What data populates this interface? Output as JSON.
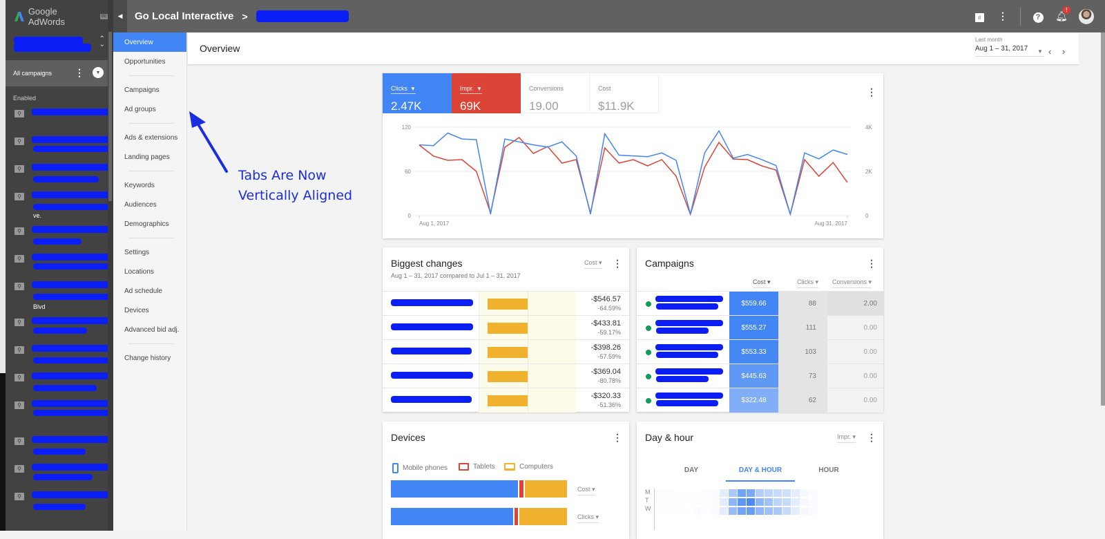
{
  "app": {
    "product_name": "Google AdWords",
    "beta_badge": "BETA"
  },
  "topbar": {
    "collapse_icon": "caret-left",
    "account_name": "Go Local Interactive",
    "separator": ">",
    "icons": [
      "reports-icon",
      "more-vert-icon",
      "help-icon",
      "notifications-icon",
      "avatar"
    ],
    "notification_badge": "!"
  },
  "sidebar": {
    "all_campaigns_label": "All campaigns",
    "enabled_label": "Enabled",
    "campaign_extra_texts": [
      "",
      "",
      "",
      "ve.",
      "",
      "",
      "Blvd",
      "",
      "",
      "",
      "",
      "",
      "",
      ""
    ]
  },
  "nav_tabs": [
    {
      "label": "Overview",
      "active": true
    },
    {
      "label": "Opportunities"
    },
    {
      "sep": true
    },
    {
      "label": "Campaigns"
    },
    {
      "label": "Ad groups"
    },
    {
      "sep": true
    },
    {
      "label": "Ads & extensions"
    },
    {
      "label": "Landing pages"
    },
    {
      "sep": true
    },
    {
      "label": "Keywords"
    },
    {
      "label": "Audiences"
    },
    {
      "label": "Demographics"
    },
    {
      "sep": true
    },
    {
      "label": "Settings"
    },
    {
      "label": "Locations"
    },
    {
      "label": "Ad schedule"
    },
    {
      "label": "Devices"
    },
    {
      "label": "Advanced bid adj."
    },
    {
      "sep": true
    },
    {
      "label": "Change history"
    }
  ],
  "page": {
    "title": "Overview",
    "date_range_label": "Last month",
    "date_range_value": "Aug 1 – 31, 2017",
    "prev": "‹",
    "next": "›"
  },
  "annotation": {
    "line1": "Tabs Are Now",
    "line2": "Vertically Aligned"
  },
  "summary_card": {
    "metrics": [
      {
        "label": "Clicks",
        "value": "2.47K",
        "color": "#4285f4",
        "selected": true
      },
      {
        "label": "Impr.",
        "value": "69K",
        "color": "#db4437",
        "selected": true
      },
      {
        "label": "Conversions",
        "value": "19.00",
        "selected": false
      },
      {
        "label": "Cost",
        "value": "$11.9K",
        "selected": false
      }
    ]
  },
  "chart_data": {
    "type": "line",
    "x": [
      "Aug 1",
      "Aug 2",
      "Aug 3",
      "Aug 4",
      "Aug 5",
      "Aug 6",
      "Aug 7",
      "Aug 8",
      "Aug 9",
      "Aug 10",
      "Aug 11",
      "Aug 12",
      "Aug 13",
      "Aug 14",
      "Aug 15",
      "Aug 16",
      "Aug 17",
      "Aug 18",
      "Aug 19",
      "Aug 20",
      "Aug 21",
      "Aug 22",
      "Aug 23",
      "Aug 24",
      "Aug 25",
      "Aug 26",
      "Aug 27",
      "Aug 28",
      "Aug 29",
      "Aug 30",
      "Aug 31"
    ],
    "x_tick_labels": [
      "Aug 1, 2017",
      "Aug 31, 2017"
    ],
    "left_axis": {
      "ticks": [
        "0",
        "60",
        "120"
      ],
      "range": [
        0,
        120
      ]
    },
    "right_axis": {
      "ticks": [
        "0",
        "2K",
        "4K"
      ],
      "range": [
        0,
        4000
      ]
    },
    "grid": true,
    "series": [
      {
        "name": "Clicks",
        "axis": "left",
        "color": "#4285f4",
        "values": [
          96,
          95,
          112,
          104,
          103,
          2,
          104,
          100,
          96,
          93,
          100,
          81,
          2,
          111,
          82,
          81,
          80,
          85,
          75,
          2,
          85,
          115,
          78,
          83,
          76,
          68,
          2,
          85,
          77,
          89,
          83
        ]
      },
      {
        "name": "Impr.",
        "axis": "right",
        "color": "#db4437",
        "values": [
          3190,
          2690,
          2500,
          2530,
          2000,
          125,
          3090,
          3530,
          2810,
          3125,
          2375,
          2530,
          125,
          3060,
          2375,
          2530,
          2250,
          2530,
          1780,
          60,
          2190,
          3310,
          2560,
          2530,
          2250,
          2060,
          60,
          2530,
          1780,
          2400,
          1500
        ]
      }
    ]
  },
  "biggest_changes": {
    "title": "Biggest changes",
    "subtitle": "Aug 1 – 31, 2017 compared to Jul 1 – 31, 2017",
    "metric_dropdown": "Cost",
    "rows": [
      {
        "amount": "-$546.57",
        "percent": "-64.59%",
        "change_fraction": 1.0
      },
      {
        "amount": "-$433.81",
        "percent": "-59.17%",
        "change_fraction": 1.0
      },
      {
        "amount": "-$398.26",
        "percent": "-57.59%",
        "change_fraction": 1.0
      },
      {
        "amount": "-$369.04",
        "percent": "-80.78%",
        "change_fraction": 1.0
      },
      {
        "amount": "-$320.33",
        "percent": "-51.36%",
        "change_fraction": 1.0
      }
    ]
  },
  "campaigns_card": {
    "title": "Campaigns",
    "columns": [
      "Cost",
      "Clicks",
      "Conversions"
    ],
    "rows": [
      {
        "cost": "$559.66",
        "clicks": "88",
        "conversions": "2.00",
        "cost_color": "#4285f4"
      },
      {
        "cost": "$555.27",
        "clicks": "111",
        "conversions": "0.00",
        "cost_color": "#4285f4"
      },
      {
        "cost": "$553.33",
        "clicks": "103",
        "conversions": "0.00",
        "cost_color": "#4588f4"
      },
      {
        "cost": "$445.63",
        "clicks": "73",
        "conversions": "0.00",
        "cost_color": "#6099f5"
      },
      {
        "cost": "$322.48",
        "clicks": "62",
        "conversions": "0.00",
        "cost_color": "#82aef7"
      }
    ]
  },
  "devices_card": {
    "title": "Devices",
    "legend": [
      {
        "label": "Mobile phones",
        "color": "#4285f4",
        "icon": "phone-icon"
      },
      {
        "label": "Tablets",
        "color": "#db4437",
        "icon": "tablet-icon"
      },
      {
        "label": "Computers",
        "color": "#f0b22e",
        "icon": "computer-icon"
      }
    ],
    "bars": [
      {
        "metric": "Cost",
        "shares": [
          0.73,
          0.03,
          0.24
        ]
      },
      {
        "metric": "Clicks",
        "shares": [
          0.7,
          0.03,
          0.27
        ]
      }
    ]
  },
  "dayhour_card": {
    "title": "Day & hour",
    "metric_dropdown": "Impr.",
    "tabs": [
      "DAY",
      "DAY & HOUR",
      "HOUR"
    ],
    "active_tab": "DAY & HOUR",
    "row_labels": [
      "M",
      "T",
      "W"
    ],
    "heat": [
      [
        0.02,
        0.02,
        0.01,
        0.01,
        0.01,
        0.02,
        0.03,
        0.15,
        0.45,
        0.75,
        0.7,
        0.4,
        0.35,
        0.3,
        0.25,
        0.15,
        0.05,
        0.03
      ],
      [
        0.02,
        0.02,
        0.02,
        0.01,
        0.01,
        0.02,
        0.03,
        0.15,
        0.6,
        0.85,
        0.95,
        0.6,
        0.5,
        0.35,
        0.3,
        0.15,
        0.05,
        0.03
      ],
      [
        0.02,
        0.02,
        0.02,
        0.01,
        0.03,
        0.02,
        0.03,
        0.15,
        0.55,
        0.75,
        0.8,
        0.6,
        0.5,
        0.45,
        0.3,
        0.15,
        0.05,
        0.03
      ]
    ]
  }
}
